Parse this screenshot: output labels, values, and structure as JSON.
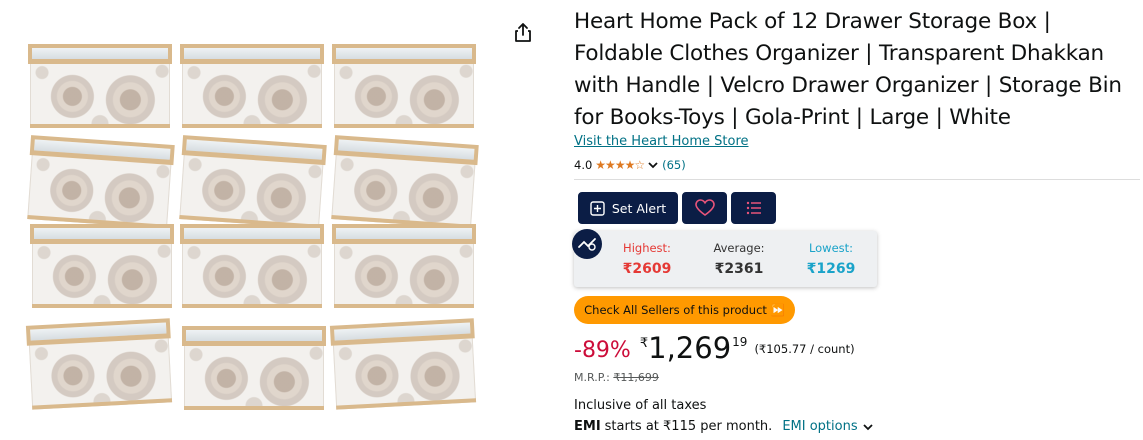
{
  "product": {
    "title": "Heart Home Pack of 12 Drawer Storage Box | Foldable Clothes Organizer | Transparent Dhakkan with Handle | Velcro Drawer Organizer | Storage Bin for Books-Toys | Gola-Print | Large | White",
    "store_link": "Visit the Heart Home Store",
    "rating_value": "4.0",
    "rating_stars": "★★★★☆",
    "rating_count": "(65)"
  },
  "tracker": {
    "set_alert_label": "Set Alert",
    "highest_label": "Highest:",
    "highest_value": "₹2609",
    "average_label": "Average:",
    "average_value": "₹2361",
    "lowest_label": "Lowest:",
    "lowest_value": "₹1269",
    "check_sellers_label": "Check All Sellers of this product ⏩",
    "colors": {
      "highest": "#e53935",
      "average": "#333333",
      "lowest": "#1aa3c9",
      "button_bg": "#0b1d45"
    }
  },
  "price": {
    "discount": "-89%",
    "symbol": "₹",
    "whole": "1,269",
    "fraction": "19",
    "unit_price": "(₹105.77 / count)",
    "mrp_label": "M.R.P.:",
    "mrp_value": "₹11,699"
  },
  "tax_text": "Inclusive of all taxes",
  "emi": {
    "bold": "EMI",
    "text": "starts at ₹115 per month.",
    "options_label": "EMI options"
  },
  "icons": [
    "share-icon",
    "star-icon",
    "chevron-down-icon",
    "plus-icon",
    "heart-icon",
    "list-icon",
    "price-chart-icon"
  ]
}
